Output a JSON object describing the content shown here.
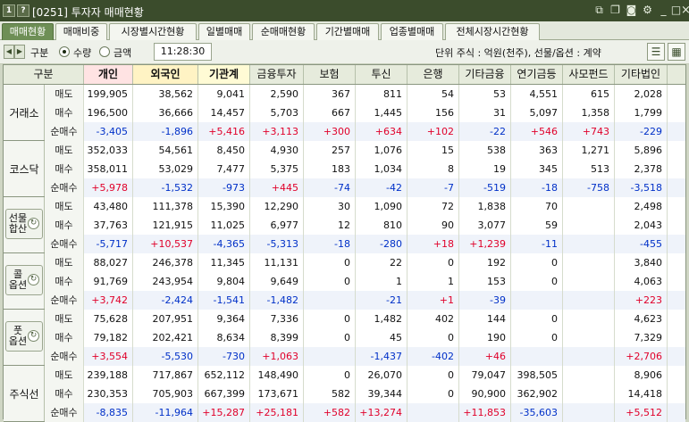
{
  "window": {
    "title": "[0251] 투자자 매매현황",
    "icons": {
      "left": [
        "1-icon",
        "question-icon"
      ],
      "right": [
        "link-icon",
        "copy-icon",
        "camera-icon",
        "gear-icon",
        "minimize-icon",
        "maximize-icon",
        "close-icon"
      ]
    }
  },
  "tabs": [
    "매매현황",
    "매매비중",
    "시장별시간현황",
    "일별매매",
    "순매매현황",
    "기간별매매",
    "업종별매매",
    "전체시장시간현황"
  ],
  "toolbar": {
    "label": "구분",
    "radio1": "수량",
    "radio2": "금액",
    "selected": "수량",
    "time": "11:28:30",
    "unit": "단위 주식 : 억원(천주), 선물/옵션 : 계약"
  },
  "colors": {
    "up": "#e0002a",
    "down": "#0030c8",
    "accent": "#6e8f56"
  },
  "columns": [
    "구분",
    "개인",
    "외국인",
    "기관계",
    "금융투자",
    "보험",
    "투신",
    "은행",
    "기타금융",
    "연기금등",
    "사모펀드",
    "기타법인"
  ],
  "groups": [
    {
      "name": "거래소",
      "button": false,
      "rows": [
        {
          "label": "매도",
          "values": [
            "199,905",
            "38,562",
            "9,041",
            "2,590",
            "367",
            "811",
            "54",
            "53",
            "4,551",
            "615",
            "2,028"
          ]
        },
        {
          "label": "매수",
          "values": [
            "196,500",
            "36,666",
            "14,457",
            "5,703",
            "667",
            "1,445",
            "156",
            "31",
            "5,097",
            "1,358",
            "1,799"
          ]
        },
        {
          "label": "순매수",
          "values": [
            "-3,405",
            "-1,896",
            "+5,416",
            "+3,113",
            "+300",
            "+634",
            "+102",
            "-22",
            "+546",
            "+743",
            "-229"
          ]
        }
      ]
    },
    {
      "name": "코스닥",
      "button": false,
      "rows": [
        {
          "label": "매도",
          "values": [
            "352,033",
            "54,561",
            "8,450",
            "4,930",
            "257",
            "1,076",
            "15",
            "538",
            "363",
            "1,271",
            "5,896"
          ]
        },
        {
          "label": "매수",
          "values": [
            "358,011",
            "53,029",
            "7,477",
            "5,375",
            "183",
            "1,034",
            "8",
            "19",
            "345",
            "513",
            "2,378"
          ]
        },
        {
          "label": "순매수",
          "values": [
            "+5,978",
            "-1,532",
            "-973",
            "+445",
            "-74",
            "-42",
            "-7",
            "-519",
            "-18",
            "-758",
            "-3,518"
          ]
        }
      ]
    },
    {
      "name": "선물 합산",
      "button": true,
      "rows": [
        {
          "label": "매도",
          "values": [
            "43,480",
            "111,378",
            "15,390",
            "12,290",
            "30",
            "1,090",
            "72",
            "1,838",
            "70",
            "",
            "2,498"
          ]
        },
        {
          "label": "매수",
          "values": [
            "37,763",
            "121,915",
            "11,025",
            "6,977",
            "12",
            "810",
            "90",
            "3,077",
            "59",
            "",
            "2,043"
          ]
        },
        {
          "label": "순매수",
          "values": [
            "-5,717",
            "+10,537",
            "-4,365",
            "-5,313",
            "-18",
            "-280",
            "+18",
            "+1,239",
            "-11",
            "",
            "-455"
          ]
        }
      ]
    },
    {
      "name": "콜 옵션",
      "button": true,
      "rows": [
        {
          "label": "매도",
          "values": [
            "88,027",
            "246,378",
            "11,345",
            "11,131",
            "0",
            "22",
            "0",
            "192",
            "0",
            "",
            "3,840"
          ]
        },
        {
          "label": "매수",
          "values": [
            "91,769",
            "243,954",
            "9,804",
            "9,649",
            "0",
            "1",
            "1",
            "153",
            "0",
            "",
            "4,063"
          ]
        },
        {
          "label": "순매수",
          "values": [
            "+3,742",
            "-2,424",
            "-1,541",
            "-1,482",
            "",
            "-21",
            "+1",
            "-39",
            "",
            "",
            "+223"
          ]
        }
      ]
    },
    {
      "name": "풋 옵션",
      "button": true,
      "rows": [
        {
          "label": "매도",
          "values": [
            "75,628",
            "207,951",
            "9,364",
            "7,336",
            "0",
            "1,482",
            "402",
            "144",
            "0",
            "",
            "4,623"
          ]
        },
        {
          "label": "매수",
          "values": [
            "79,182",
            "202,421",
            "8,634",
            "8,399",
            "0",
            "45",
            "0",
            "190",
            "0",
            "",
            "7,329"
          ]
        },
        {
          "label": "순매수",
          "values": [
            "+3,554",
            "-5,530",
            "-730",
            "+1,063",
            "",
            "-1,437",
            "-402",
            "+46",
            "",
            "",
            "+2,706"
          ]
        }
      ]
    },
    {
      "name": "주식선",
      "button": false,
      "rows": [
        {
          "label": "매도",
          "values": [
            "239,188",
            "717,867",
            "652,112",
            "148,490",
            "0",
            "26,070",
            "0",
            "79,047",
            "398,505",
            "",
            "8,906"
          ]
        },
        {
          "label": "매수",
          "values": [
            "230,353",
            "705,903",
            "667,399",
            "173,671",
            "582",
            "39,344",
            "0",
            "90,900",
            "362,902",
            "",
            "14,418"
          ]
        },
        {
          "label": "순매수",
          "values": [
            "-8,835",
            "-11,964",
            "+15,287",
            "+25,181",
            "+582",
            "+13,274",
            "",
            "+11,853",
            "-35,603",
            "",
            "+5,512"
          ]
        }
      ]
    }
  ]
}
